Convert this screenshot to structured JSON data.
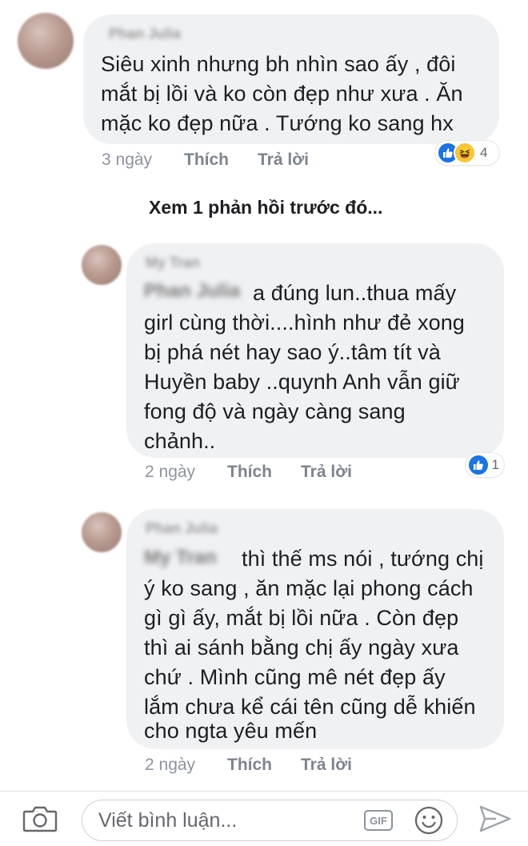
{
  "comments": [
    {
      "author": "Phan Julia",
      "mention": "",
      "lines": [
        "Siêu xinh nhưng bh nhìn sao ấy , đôi",
        "mắt bị lồi và ko còn đẹp như xưa . Ăn",
        "mặc ko đẹp nữa . Tướng ko sang hx"
      ],
      "time": "3 ngày",
      "like_label": "Thích",
      "reply_label": "Trả lời",
      "reaction_icons": [
        "like-icon",
        "haha-icon"
      ],
      "reaction_count": "4"
    },
    {
      "author": "My Tran",
      "mention": "Phan Julia",
      "lines": [
        "a đúng lun..thua mấy",
        "girl cùng thời....hình như đẻ xong",
        "bị phá nét hay sao ý..tâm tít và",
        "Huyền baby ..quynh Anh vẫn giữ",
        "fong độ và ngày càng sang",
        "chảnh.."
      ],
      "time": "2 ngày",
      "like_label": "Thích",
      "reply_label": "Trả lời",
      "reaction_icons": [
        "like-icon"
      ],
      "reaction_count": "1"
    },
    {
      "author": "Phan Julia",
      "mention": "My Tran",
      "lines": [
        "thì thế ms nói , tướng chị",
        "ý ko sang , ăn mặc lại phong cách",
        "gì gì ấy, mắt bị lồi nữa . Còn đẹp",
        "thì ai sánh bằng chị ấy ngày xưa",
        "chứ . Mình cũng mê nét đẹp ấy",
        "lắm chưa kể cái tên cũng dễ khiến",
        "cho ngta yêu mến"
      ],
      "time": "2 ngày",
      "like_label": "Thích",
      "reply_label": "Trả lời",
      "reaction_icons": [],
      "reaction_count": ""
    }
  ],
  "view_previous": "Xem 1 phản hồi trước đó...",
  "composer": {
    "placeholder": "Viết bình luận...",
    "gif_label": "GIF",
    "icons": [
      "camera-icon",
      "gif-icon",
      "sticker-icon",
      "send-icon"
    ]
  },
  "colors": {
    "bubble": "#f0f1f3",
    "meta_text": "#8d949e",
    "like_blue": "#1b74e4",
    "haha_yellow": "#f7c633"
  }
}
